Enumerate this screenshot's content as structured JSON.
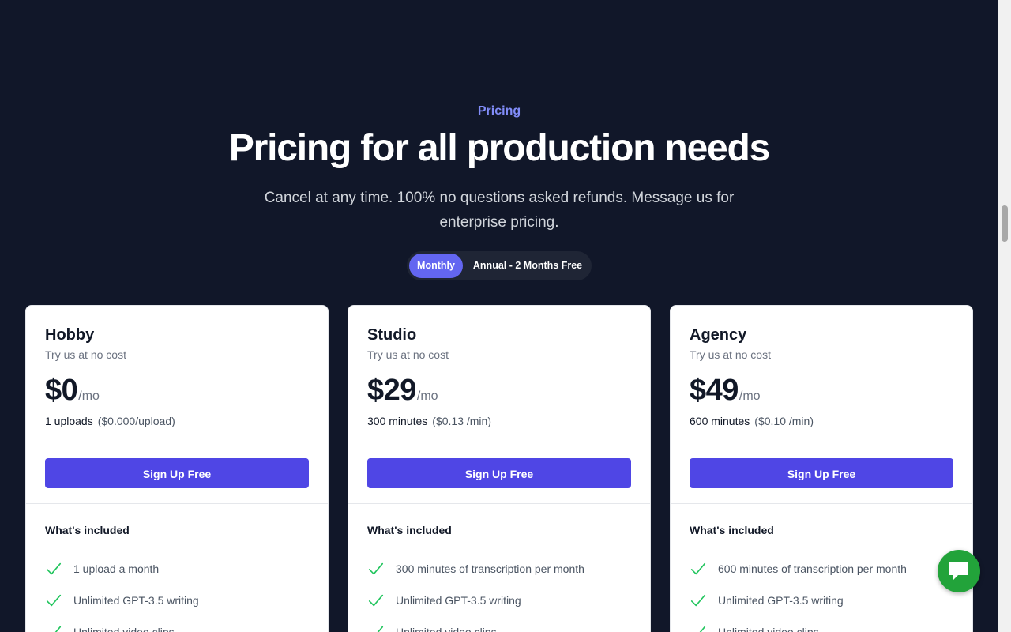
{
  "header": {
    "eyebrow": "Pricing",
    "title": "Pricing for all production needs",
    "subtitle": "Cancel at any time. 100% no questions asked refunds. Message us for enterprise pricing."
  },
  "billing_toggle": {
    "options": [
      "Monthly",
      "Annual - 2 Months Free"
    ],
    "selected": "Monthly"
  },
  "plans": [
    {
      "name": "Hobby",
      "description": "Try us at no cost",
      "price": "$0",
      "period": "/mo",
      "usage": "1 uploads",
      "rate": "($0.000/upload)",
      "cta": "Sign Up Free",
      "included_label": "What's included",
      "features": [
        "1 upload a month",
        "Unlimited GPT-3.5 writing",
        "Unlimited video clips"
      ]
    },
    {
      "name": "Studio",
      "description": "Try us at no cost",
      "price": "$29",
      "period": "/mo",
      "usage": "300 minutes",
      "rate": "($0.13 /min)",
      "cta": "Sign Up Free",
      "included_label": "What's included",
      "features": [
        "300 minutes of transcription per month",
        "Unlimited GPT-3.5 writing",
        "Unlimited video clips"
      ]
    },
    {
      "name": "Agency",
      "description": "Try us at no cost",
      "price": "$49",
      "period": "/mo",
      "usage": "600 minutes",
      "rate": "($0.10 /min)",
      "cta": "Sign Up Free",
      "included_label": "What's included",
      "features": [
        "600 minutes of transcription per month",
        "Unlimited GPT-3.5 writing",
        "Unlimited video clips"
      ]
    }
  ],
  "chat": {
    "icon": "chat-bubble-icon"
  },
  "colors": {
    "background": "#111729",
    "accent": "#4f46e5",
    "eyebrow": "#818cf8",
    "check": "#22c55e",
    "chat": "#22a33a"
  }
}
